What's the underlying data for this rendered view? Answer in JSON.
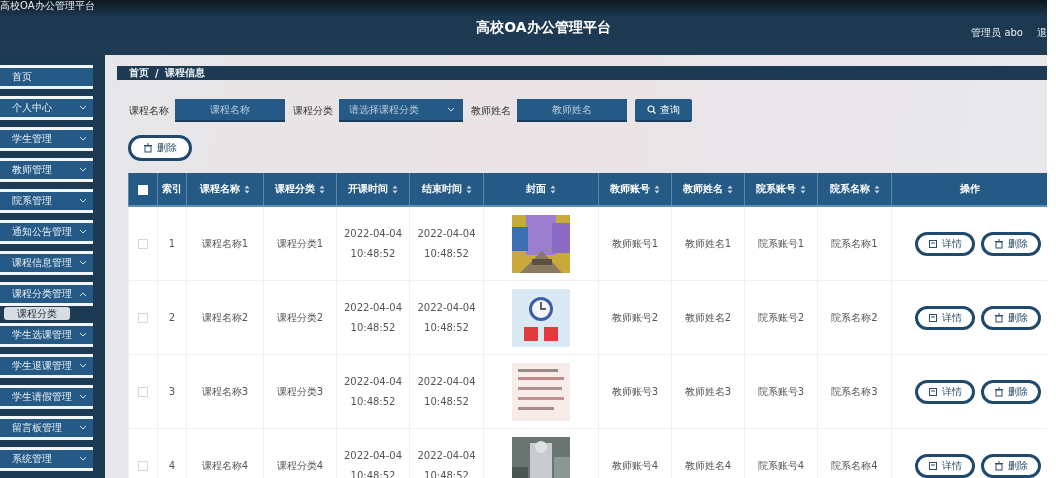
{
  "window": {
    "title": "高校OA办公管理平台"
  },
  "header": {
    "title": "高校OA办公管理平台",
    "user": "管理员 abo",
    "logout": "退"
  },
  "sidebar": {
    "items": [
      {
        "label": "首页",
        "kind": "link"
      },
      {
        "label": "个人中心",
        "kind": "menu",
        "expanded": false
      },
      {
        "label": "学生管理",
        "kind": "menu",
        "expanded": false
      },
      {
        "label": "教师管理",
        "kind": "menu",
        "expanded": false
      },
      {
        "label": "院系管理",
        "kind": "menu",
        "expanded": false
      },
      {
        "label": "通知公告管理",
        "kind": "menu",
        "expanded": false
      },
      {
        "label": "课程信息管理",
        "kind": "menu",
        "expanded": false
      },
      {
        "label": "课程分类管理",
        "kind": "menu",
        "expanded": true,
        "children": [
          {
            "label": "课程分类",
            "selected": true
          }
        ]
      },
      {
        "label": "学生选课管理",
        "kind": "menu",
        "expanded": false
      },
      {
        "label": "学生退课管理",
        "kind": "menu",
        "expanded": false
      },
      {
        "label": "学生请假管理",
        "kind": "menu",
        "expanded": false
      },
      {
        "label": "留言板管理",
        "kind": "menu",
        "expanded": false
      },
      {
        "label": "系统管理",
        "kind": "menu",
        "expanded": false
      }
    ]
  },
  "breadcrumb": [
    "首页",
    "/",
    "课程信息"
  ],
  "search": {
    "fields": [
      {
        "kind": "input",
        "label": "课程名称",
        "placeholder": "课程名称"
      },
      {
        "kind": "select",
        "label": "课程分类",
        "placeholder": "请选择课程分类"
      },
      {
        "kind": "input",
        "label": "教师姓名",
        "placeholder": "教师姓名"
      }
    ],
    "button": "查询"
  },
  "delete_button": "删除",
  "table": {
    "select_all": {
      "checked": false
    },
    "columns": [
      {
        "label": "索引",
        "kind": "plain"
      },
      {
        "label": "课程名称",
        "kind": "sortable"
      },
      {
        "label": "课程分类",
        "kind": "sortable"
      },
      {
        "label": "开课时间",
        "kind": "sortable"
      },
      {
        "label": "结束时间",
        "kind": "sortable"
      },
      {
        "label": "封面",
        "kind": "sortable"
      },
      {
        "label": "教师账号",
        "kind": "sortable"
      },
      {
        "label": "教师姓名",
        "kind": "sortable"
      },
      {
        "label": "院系账号",
        "kind": "sortable"
      },
      {
        "label": "院系名称",
        "kind": "sortable"
      },
      {
        "label": "操作",
        "kind": "plain"
      }
    ],
    "rows": [
      {
        "checked": false,
        "cells": [
          "1",
          "课程名称1",
          "课程分类1",
          "2022-04-04 10:48:52",
          "2022-04-04 10:48:52",
          {
            "kind": "picture"
          },
          "教师账号1",
          "教师姓名1",
          "院系账号1",
          "院系名称1"
        ],
        "actions": [
          "详情",
          "删除"
        ]
      },
      {
        "checked": false,
        "cells": [
          "2",
          "课程名称2",
          "课程分类2",
          "2022-04-04 10:48:52",
          "2022-04-04 10:48:52",
          {
            "kind": "picture"
          },
          "教师账号2",
          "教师姓名2",
          "院系账号2",
          "院系名称2"
        ],
        "actions": [
          "详情",
          "删除"
        ]
      },
      {
        "checked": false,
        "cells": [
          "3",
          "课程名称3",
          "课程分类3",
          "2022-04-04 10:48:52",
          "2022-04-04 10:48:52",
          {
            "kind": "picture"
          },
          "教师账号3",
          "教师姓名3",
          "院系账号3",
          "院系名称3"
        ],
        "actions": [
          "详情",
          "删除"
        ]
      },
      {
        "checked": false,
        "cells": [
          "4",
          "课程名称4",
          "课程分类4",
          "2022-04-04 10:48:52",
          "2022-04-04 10:48:52",
          {
            "kind": "picture"
          },
          "教师账号4",
          "教师姓名4",
          "院系账号4",
          "院系名称4"
        ],
        "actions": [
          "详情",
          "删除"
        ]
      }
    ]
  }
}
